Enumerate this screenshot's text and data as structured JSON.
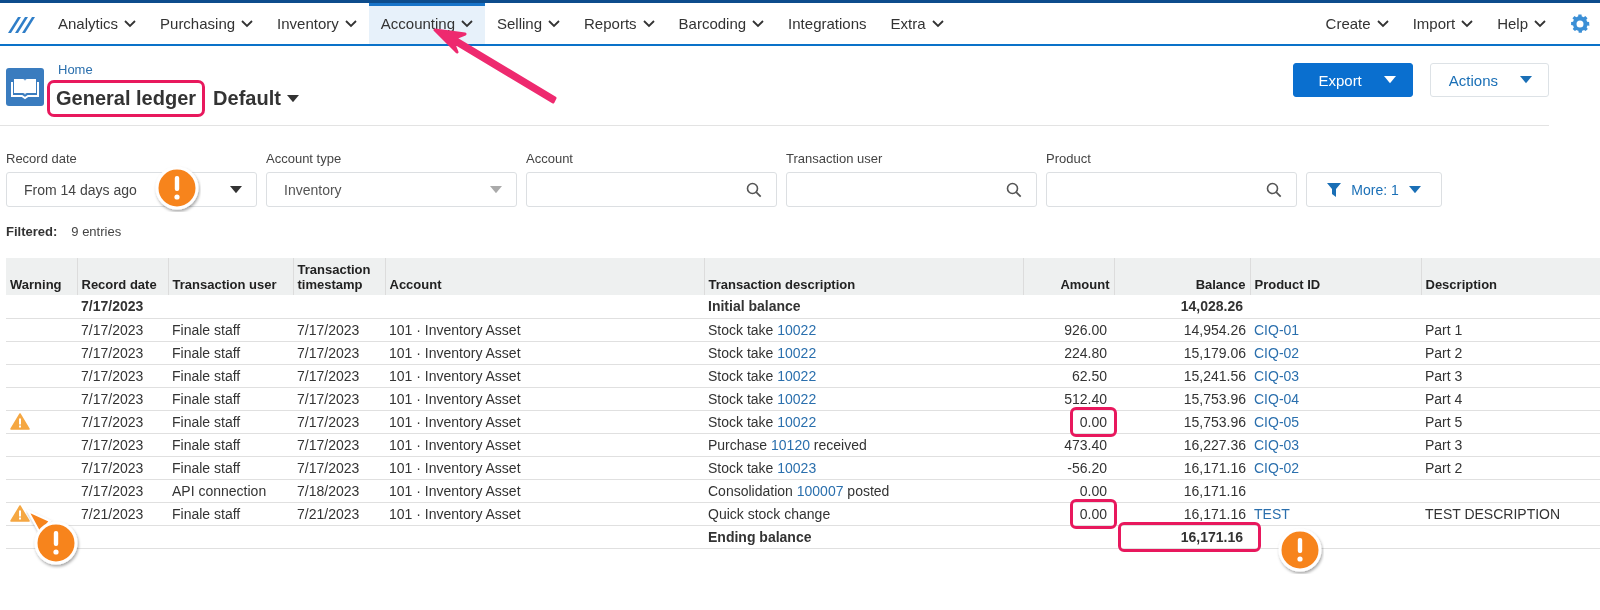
{
  "nav": {
    "items": [
      {
        "label": "Analytics",
        "dropdown": true,
        "selected": false,
        "pointed": false
      },
      {
        "label": "Purchasing",
        "dropdown": true,
        "selected": false,
        "pointed": false
      },
      {
        "label": "Inventory",
        "dropdown": true,
        "selected": false,
        "pointed": false
      },
      {
        "label": "Accounting",
        "dropdown": true,
        "selected": true,
        "pointed": true
      },
      {
        "label": "Selling",
        "dropdown": true,
        "selected": false,
        "pointed": false
      },
      {
        "label": "Reports",
        "dropdown": true,
        "selected": false,
        "pointed": false
      },
      {
        "label": "Barcoding",
        "dropdown": true,
        "selected": false,
        "pointed": false
      },
      {
        "label": "Integrations",
        "dropdown": false,
        "selected": false,
        "pointed": false
      },
      {
        "label": "Extra",
        "dropdown": true,
        "selected": false,
        "pointed": false
      }
    ],
    "right_items": [
      {
        "label": "Create",
        "dropdown": true
      },
      {
        "label": "Import",
        "dropdown": true
      },
      {
        "label": "Help",
        "dropdown": true
      }
    ]
  },
  "header": {
    "breadcrumb": "Home",
    "title": "General ledger",
    "title_highlighted": true,
    "view": "Default",
    "buttons": [
      {
        "label": "Export",
        "kind": "primary"
      },
      {
        "label": "Actions",
        "kind": "secondary"
      }
    ]
  },
  "filters": [
    {
      "label": "Record date",
      "kind": "select",
      "value": "From 14 days ago",
      "callout": true
    },
    {
      "label": "Account type",
      "kind": "select",
      "value": "Inventory",
      "callout": false,
      "disabled": true
    },
    {
      "label": "Account",
      "kind": "search"
    },
    {
      "label": "Transaction user",
      "kind": "search"
    },
    {
      "label": "Product",
      "kind": "search"
    }
  ],
  "more_button": "More: 1",
  "filtered": {
    "label": "Filtered:",
    "value": "9 entries"
  },
  "table": {
    "columns": [
      "Warning",
      "Record date",
      "Transaction user",
      "Transaction timestamp",
      "Account",
      "Transaction description",
      "Amount",
      "Balance",
      "Product ID",
      "Description"
    ],
    "rows": [
      {
        "kind": "summary",
        "warning": false,
        "callout": false,
        "record_date": "7/17/2023",
        "description": [
          {
            "text": "Initial balance",
            "link": false
          }
        ],
        "balance": "14,028.26",
        "balance_highlighted": false,
        "balance_callout": false
      },
      {
        "kind": "entry",
        "warning": false,
        "callout": false,
        "record_date": "7/17/2023",
        "user": "Finale staff",
        "timestamp": "7/17/2023",
        "account": "101 · Inventory Asset",
        "description": [
          {
            "text": "Stock take ",
            "link": false
          },
          {
            "text": "10022",
            "link": true
          }
        ],
        "amount": "926.00",
        "amount_highlighted": false,
        "balance": "14,954.26",
        "product_id": "CIQ-01",
        "item_description": "Part 1"
      },
      {
        "kind": "entry",
        "warning": false,
        "callout": false,
        "record_date": "7/17/2023",
        "user": "Finale staff",
        "timestamp": "7/17/2023",
        "account": "101 · Inventory Asset",
        "description": [
          {
            "text": "Stock take ",
            "link": false
          },
          {
            "text": "10022",
            "link": true
          }
        ],
        "amount": "224.80",
        "amount_highlighted": false,
        "balance": "15,179.06",
        "product_id": "CIQ-02",
        "item_description": "Part 2"
      },
      {
        "kind": "entry",
        "warning": false,
        "callout": false,
        "record_date": "7/17/2023",
        "user": "Finale staff",
        "timestamp": "7/17/2023",
        "account": "101 · Inventory Asset",
        "description": [
          {
            "text": "Stock take ",
            "link": false
          },
          {
            "text": "10022",
            "link": true
          }
        ],
        "amount": "62.50",
        "amount_highlighted": false,
        "balance": "15,241.56",
        "product_id": "CIQ-03",
        "item_description": "Part 3"
      },
      {
        "kind": "entry",
        "warning": false,
        "callout": false,
        "record_date": "7/17/2023",
        "user": "Finale staff",
        "timestamp": "7/17/2023",
        "account": "101 · Inventory Asset",
        "description": [
          {
            "text": "Stock take ",
            "link": false
          },
          {
            "text": "10022",
            "link": true
          }
        ],
        "amount": "512.40",
        "amount_highlighted": false,
        "balance": "15,753.96",
        "product_id": "CIQ-04",
        "item_description": "Part 4"
      },
      {
        "kind": "entry",
        "warning": true,
        "callout": false,
        "record_date": "7/17/2023",
        "user": "Finale staff",
        "timestamp": "7/17/2023",
        "account": "101 · Inventory Asset",
        "description": [
          {
            "text": "Stock take ",
            "link": false
          },
          {
            "text": "10022",
            "link": true
          }
        ],
        "amount": "0.00",
        "amount_highlighted": true,
        "balance": "15,753.96",
        "product_id": "CIQ-05",
        "item_description": "Part 5"
      },
      {
        "kind": "entry",
        "warning": false,
        "callout": false,
        "record_date": "7/17/2023",
        "user": "Finale staff",
        "timestamp": "7/17/2023",
        "account": "101 · Inventory Asset",
        "description": [
          {
            "text": "Purchase ",
            "link": false
          },
          {
            "text": "10120",
            "link": true
          },
          {
            "text": " received",
            "link": false
          }
        ],
        "amount": "473.40",
        "amount_highlighted": false,
        "balance": "16,227.36",
        "product_id": "CIQ-03",
        "item_description": "Part 3"
      },
      {
        "kind": "entry",
        "warning": false,
        "callout": false,
        "record_date": "7/17/2023",
        "user": "Finale staff",
        "timestamp": "7/17/2023",
        "account": "101 · Inventory Asset",
        "description": [
          {
            "text": "Stock take ",
            "link": false
          },
          {
            "text": "10023",
            "link": true
          }
        ],
        "amount": "-56.20",
        "amount_highlighted": false,
        "balance": "16,171.16",
        "product_id": "CIQ-02",
        "item_description": "Part 2"
      },
      {
        "kind": "entry",
        "warning": false,
        "callout": false,
        "record_date": "7/17/2023",
        "user": "API connection",
        "timestamp": "7/18/2023",
        "account": "101 · Inventory Asset",
        "description": [
          {
            "text": "Consolidation ",
            "link": false
          },
          {
            "text": "100007",
            "link": true
          },
          {
            "text": " posted",
            "link": false
          }
        ],
        "amount": "0.00",
        "amount_highlighted": false,
        "balance": "16,171.16"
      },
      {
        "kind": "entry",
        "warning": true,
        "callout": true,
        "record_date": "7/21/2023",
        "user": "Finale staff",
        "timestamp": "7/21/2023",
        "account": "101 · Inventory Asset",
        "description": [
          {
            "text": "Quick stock change",
            "link": false
          }
        ],
        "amount": "0.00",
        "amount_highlighted": true,
        "balance": "16,171.16",
        "product_id": "TEST",
        "item_description": "TEST DESCRIPTION"
      },
      {
        "kind": "summary",
        "warning": false,
        "callout": false,
        "description": [
          {
            "text": "Ending balance",
            "link": false
          }
        ],
        "balance": "16,171.16",
        "balance_highlighted": true,
        "balance_callout": true
      }
    ]
  }
}
